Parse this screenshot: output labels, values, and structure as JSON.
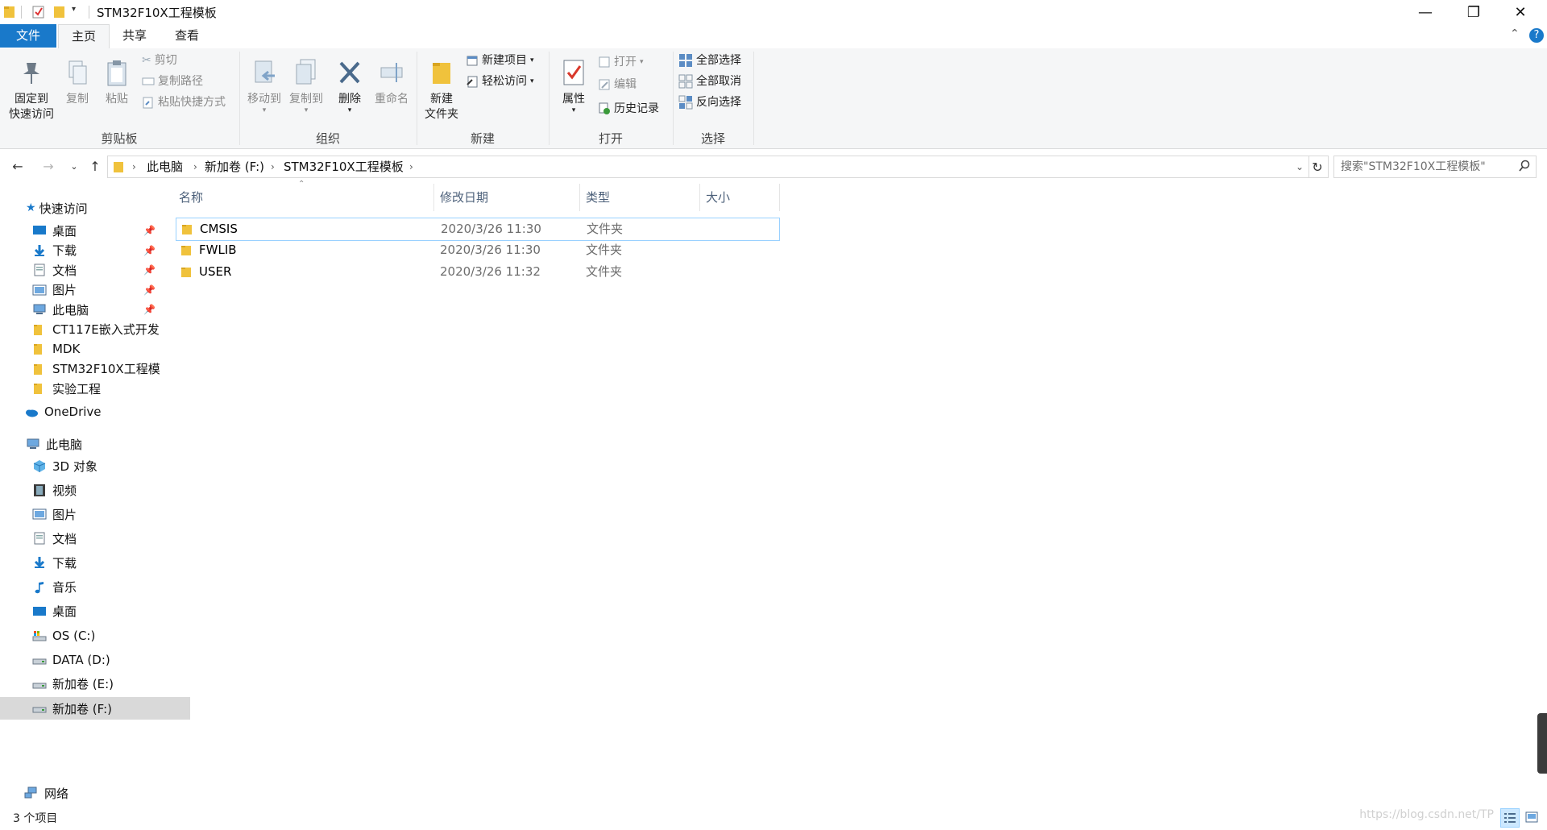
{
  "window": {
    "title": "STM32F10X工程模板",
    "controls": {
      "minimize": "—",
      "restore": "❐",
      "close": "✕"
    },
    "help": "?"
  },
  "tabs": [
    {
      "label": "文件",
      "state": "file"
    },
    {
      "label": "主页",
      "state": "active"
    },
    {
      "label": "共享",
      "state": ""
    },
    {
      "label": "查看",
      "state": ""
    }
  ],
  "ribbon": {
    "clipboard": {
      "group": "剪贴板",
      "pin": "固定到\n快速访问",
      "pin_l1": "固定到",
      "pin_l2": "快速访问",
      "copy": "复制",
      "paste": "粘贴",
      "cut": "剪切",
      "copy_path": "复制路径",
      "paste_shortcut": "粘贴快捷方式"
    },
    "organize": {
      "group": "组织",
      "move_to": "移动到",
      "copy_to": "复制到",
      "delete": "删除",
      "rename": "重命名"
    },
    "new": {
      "group": "新建",
      "new_folder_l1": "新建",
      "new_folder_l2": "文件夹",
      "new_item": "新建项目",
      "easy_access": "轻松访问"
    },
    "open": {
      "group": "打开",
      "properties": "属性",
      "open": "打开",
      "edit": "编辑",
      "history": "历史记录"
    },
    "select": {
      "group": "选择",
      "select_all": "全部选择",
      "select_none": "全部取消",
      "invert": "反向选择"
    }
  },
  "address": {
    "crumbs": [
      "此电脑",
      "新加卷 (F:)",
      "STM32F10X工程模板"
    ],
    "search_placeholder": "搜索\"STM32F10X工程模板\""
  },
  "nav": {
    "quick_access": "快速访问",
    "quick_items": [
      {
        "label": "桌面",
        "icon": "desktop-icon",
        "pinned": true
      },
      {
        "label": "下载",
        "icon": "download-icon",
        "pinned": true
      },
      {
        "label": "文档",
        "icon": "document-icon",
        "pinned": true
      },
      {
        "label": "图片",
        "icon": "picture-icon",
        "pinned": true
      },
      {
        "label": "此电脑",
        "icon": "computer-icon",
        "pinned": true
      },
      {
        "label": "CT117E嵌入式开发",
        "icon": "folder-icon",
        "pinned": false
      },
      {
        "label": "MDK",
        "icon": "folder-icon",
        "pinned": false
      },
      {
        "label": "STM32F10X工程模",
        "icon": "folder-icon",
        "pinned": false
      },
      {
        "label": "实验工程",
        "icon": "folder-icon",
        "pinned": false
      }
    ],
    "onedrive": "OneDrive",
    "this_pc": "此电脑",
    "pc_items": [
      {
        "label": "3D 对象",
        "icon": "3d-objects-icon"
      },
      {
        "label": "视频",
        "icon": "video-icon"
      },
      {
        "label": "图片",
        "icon": "picture-icon"
      },
      {
        "label": "文档",
        "icon": "document-icon"
      },
      {
        "label": "下载",
        "icon": "download-icon"
      },
      {
        "label": "音乐",
        "icon": "music-icon"
      },
      {
        "label": "桌面",
        "icon": "desktop-icon"
      },
      {
        "label": "OS (C:)",
        "icon": "system-drive-icon"
      },
      {
        "label": "DATA (D:)",
        "icon": "drive-icon"
      },
      {
        "label": "新加卷 (E:)",
        "icon": "drive-icon"
      },
      {
        "label": "新加卷 (F:)",
        "icon": "drive-icon",
        "selected": true
      }
    ],
    "network": "网络"
  },
  "columns": {
    "name": "名称",
    "modified": "修改日期",
    "type": "类型",
    "size": "大小"
  },
  "files": [
    {
      "name": "CMSIS",
      "modified": "2020/3/26 11:30",
      "type": "文件夹",
      "size": ""
    },
    {
      "name": "FWLIB",
      "modified": "2020/3/26 11:30",
      "type": "文件夹",
      "size": ""
    },
    {
      "name": "USER",
      "modified": "2020/3/26 11:32",
      "type": "文件夹",
      "size": ""
    }
  ],
  "status": {
    "count": "3 个项目"
  },
  "watermark": "https://blog.csdn.net/TP",
  "colors": {
    "accent": "#1979ca",
    "folder": "#f0c23c",
    "selection": "#cce8ff"
  }
}
